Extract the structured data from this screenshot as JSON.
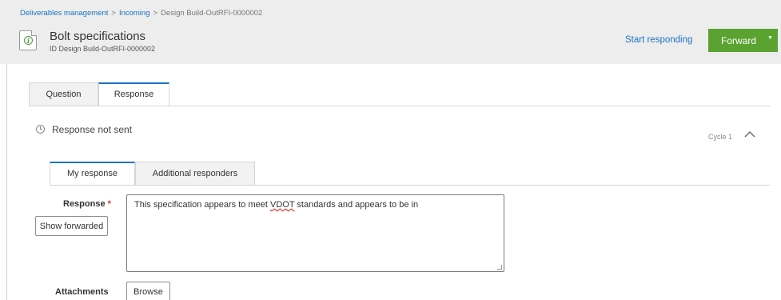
{
  "breadcrumb": {
    "items": [
      "Deliverables management",
      "Incoming"
    ],
    "separator": ">",
    "current": "Design Build-OutRFI-0000002"
  },
  "header": {
    "title": "Bolt specifications",
    "subtitle": "ID Design Build-OutRFI-0000002",
    "icon": "info-document-icon",
    "start_responding": "Start responding",
    "forward_label": "Forward",
    "forward_color": "#5aa330",
    "link_color": "#1a73c7"
  },
  "main_tabs": [
    {
      "label": "Question",
      "active": false
    },
    {
      "label": "Response",
      "active": true
    }
  ],
  "response_section": {
    "status": "Response not sent",
    "cycle": "Cycle 1"
  },
  "sub_tabs": [
    {
      "label": "My response",
      "active": true
    },
    {
      "label": "Additional responders",
      "active": false
    }
  ],
  "form": {
    "response_label": "Response",
    "required_marker": "*",
    "show_forwarded": "Show forwarded",
    "response_text_pre": "This specification appears to meet ",
    "response_text_flagged": "VDOT",
    "response_text_post": " standards and appears to be in",
    "attachments_label": "Attachments",
    "browse_label": "Browse"
  }
}
